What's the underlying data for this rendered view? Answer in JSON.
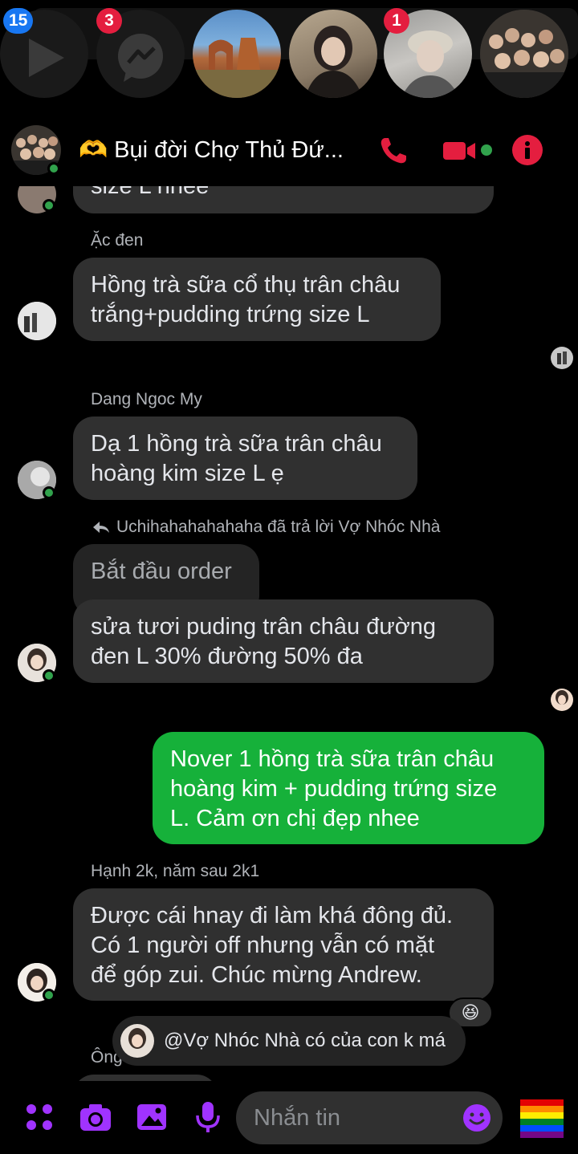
{
  "chatheads": {
    "items": [
      {
        "name": "video-head",
        "badge": "15",
        "badge_color": "blue"
      },
      {
        "name": "messenger-head",
        "badge": "3",
        "badge_color": "red"
      },
      {
        "name": "arch-head",
        "badge": ""
      },
      {
        "name": "girl-head",
        "badge": ""
      },
      {
        "name": "cap-head",
        "badge": "1",
        "badge_color": "red"
      },
      {
        "name": "group-head",
        "badge": ""
      }
    ]
  },
  "header": {
    "title": "🫶 Bụi đời Chợ Thủ Đứ..."
  },
  "messages": {
    "partial_top": "size L nhee",
    "m1": {
      "sender": "Ặc đen",
      "lines": [
        "Hồng trà sữa cổ thụ trân châu",
        "trắng+pudding trứng size L"
      ]
    },
    "m2": {
      "sender": "Dang Ngoc My",
      "lines": [
        "Dạ 1 hồng trà sữa trân châu",
        "hoàng kim size L ẹ"
      ]
    },
    "reply_note": "Uchihahahahahaha đã trả lời Vợ Nhóc Nhà",
    "quoted": "Bắt đầu order",
    "m3": {
      "lines": [
        "sửa tươi puding trân châu đường",
        "đen L 30% đường 50% đa"
      ]
    },
    "mine": {
      "lines": [
        "Nover 1 hồng trà sữa trân châu",
        "hoàng kim + pudding trứng size",
        "L. Cảm ơn chị đẹp nhee"
      ]
    },
    "m4": {
      "sender": "Hạnh 2k, năm sau 2k1",
      "lines": [
        "Được cái hnay đi làm khá đông đủ.",
        "Có 1 người off nhưng vẫn có mặt",
        "để góp zui. Chúc mừng Andrew."
      ],
      "reaction": "😆"
    },
    "mention_popup": "@Vợ Nhóc Nhà có của con k má",
    "partial_sender": "Ông"
  },
  "composer": {
    "placeholder": "Nhắn tin"
  },
  "colors": {
    "accent": "#a033ff",
    "danger": "#e41e3f",
    "online": "#31a24c",
    "my_bubble": "#16b13a",
    "their_bubble": "#303030"
  }
}
